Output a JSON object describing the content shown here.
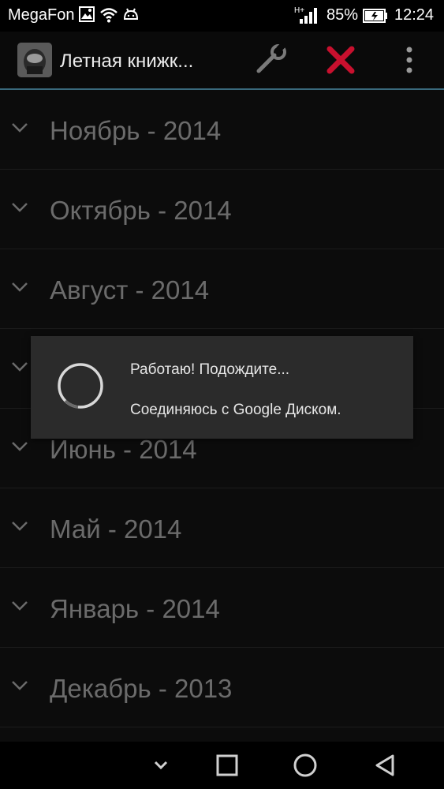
{
  "status_bar": {
    "carrier": "MegaFon",
    "battery_percent": "85%",
    "time": "12:24",
    "icons": [
      "image-icon",
      "wifi-icon",
      "android-debug-icon",
      "signal-h-plus-icon",
      "battery-charging-icon"
    ]
  },
  "action_bar": {
    "title": "Летная книжк...",
    "icons": [
      "app-icon",
      "wrench-icon",
      "close-x-icon",
      "overflow-menu-icon"
    ],
    "accent_color": "#c8102e"
  },
  "months": [
    {
      "label": "Ноябрь - 2014"
    },
    {
      "label": "Октябрь - 2014"
    },
    {
      "label": "Август - 2014"
    },
    {
      "label": ""
    },
    {
      "label": "Июнь - 2014"
    },
    {
      "label": "Май - 2014"
    },
    {
      "label": "Январь - 2014"
    },
    {
      "label": "Декабрь - 2013"
    }
  ],
  "dialog": {
    "title": "Работаю! Подождите...",
    "message": "Соединяюсь с Google Диском."
  },
  "nav_bar": {
    "icons": [
      "chevron-down-icon",
      "recents-icon",
      "home-icon",
      "back-icon"
    ]
  }
}
